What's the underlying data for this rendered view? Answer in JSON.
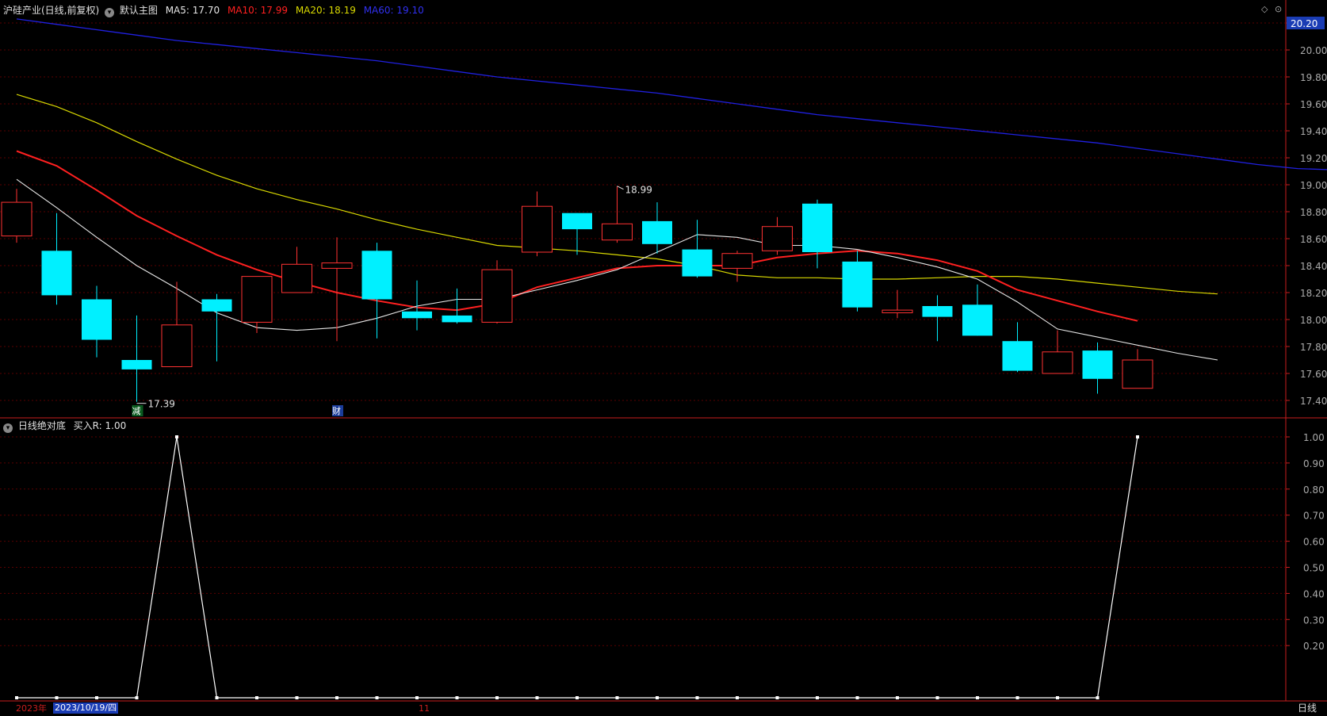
{
  "header": {
    "stock_title": "沪硅产业(日线,前复权)",
    "main_chart_label": "默认主图",
    "ma5_label": "MA5: 17.70",
    "ma10_label": "MA10: 17.99",
    "ma20_label": "MA20: 18.19",
    "ma60_label": "MA60: 19.10"
  },
  "indicator_header": {
    "name": "日线绝对底",
    "value_label": "买入R: 1.00"
  },
  "colors": {
    "background": "#000000",
    "grid": "#5a0000",
    "axis": "#c81e1e",
    "up": "#ff3232",
    "down": "#00f0ff",
    "ma5": "#e6e6e6",
    "ma10": "#ff2020",
    "ma20": "#d8d800",
    "ma60": "#2020e0",
    "indicator": "#ffffff",
    "current_price_bg": "#1a3cb4"
  },
  "price_axis": {
    "ticks": [
      "20.20",
      "20.00",
      "19.80",
      "19.60",
      "19.40",
      "19.20",
      "19.00",
      "18.80",
      "18.60",
      "18.40",
      "18.20",
      "18.00",
      "17.80",
      "17.60",
      "17.40"
    ],
    "highlight": "20.20"
  },
  "indicator_axis": {
    "ticks": [
      "1.00",
      "0.90",
      "0.80",
      "0.70",
      "0.60",
      "0.50",
      "0.40",
      "0.30",
      "0.20"
    ]
  },
  "annotations": {
    "high_label": "18.99",
    "low_label": "17.39",
    "marker_reduce": "减",
    "marker_finance": "财"
  },
  "bottom_bar": {
    "year": "2023年",
    "cursor_date": "2023/10/19/四",
    "month_marker": "11",
    "period": "日线"
  },
  "chart_data": [
    {
      "type": "candlestick",
      "title": "沪硅产业(日线,前复权)",
      "ylim": [
        17.28,
        20.23
      ],
      "candles": [
        {
          "o": 18.62,
          "h": 18.97,
          "l": 18.57,
          "c": 18.87
        },
        {
          "o": 18.51,
          "h": 18.79,
          "l": 18.11,
          "c": 18.18
        },
        {
          "o": 18.15,
          "h": 18.25,
          "l": 17.72,
          "c": 17.85
        },
        {
          "o": 17.7,
          "h": 18.03,
          "l": 17.39,
          "c": 17.63
        },
        {
          "o": 17.65,
          "h": 18.28,
          "l": 17.65,
          "c": 17.96
        },
        {
          "o": 18.15,
          "h": 18.19,
          "l": 17.69,
          "c": 18.06
        },
        {
          "o": 17.98,
          "h": 18.32,
          "l": 17.9,
          "c": 18.32
        },
        {
          "o": 18.2,
          "h": 18.54,
          "l": 18.2,
          "c": 18.41
        },
        {
          "o": 18.38,
          "h": 18.61,
          "l": 17.84,
          "c": 18.42
        },
        {
          "o": 18.51,
          "h": 18.57,
          "l": 17.86,
          "c": 18.15
        },
        {
          "o": 18.06,
          "h": 18.29,
          "l": 17.92,
          "c": 18.01
        },
        {
          "o": 18.03,
          "h": 18.23,
          "l": 17.97,
          "c": 17.98
        },
        {
          "o": 17.98,
          "h": 18.44,
          "l": 17.97,
          "c": 18.37
        },
        {
          "o": 18.5,
          "h": 18.95,
          "l": 18.47,
          "c": 18.84
        },
        {
          "o": 18.79,
          "h": 18.79,
          "l": 18.48,
          "c": 18.67
        },
        {
          "o": 18.59,
          "h": 18.99,
          "l": 18.57,
          "c": 18.71
        },
        {
          "o": 18.73,
          "h": 18.87,
          "l": 18.49,
          "c": 18.56
        },
        {
          "o": 18.52,
          "h": 18.74,
          "l": 18.31,
          "c": 18.32
        },
        {
          "o": 18.38,
          "h": 18.51,
          "l": 18.28,
          "c": 18.49
        },
        {
          "o": 18.51,
          "h": 18.76,
          "l": 18.48,
          "c": 18.69
        },
        {
          "o": 18.86,
          "h": 18.89,
          "l": 18.38,
          "c": 18.5
        },
        {
          "o": 18.43,
          "h": 18.51,
          "l": 18.06,
          "c": 18.09
        },
        {
          "o": 18.05,
          "h": 18.22,
          "l": 18.01,
          "c": 18.07
        },
        {
          "o": 18.1,
          "h": 18.18,
          "l": 17.84,
          "c": 18.02
        },
        {
          "o": 18.11,
          "h": 18.26,
          "l": 17.88,
          "c": 17.88
        },
        {
          "o": 17.84,
          "h": 17.98,
          "l": 17.61,
          "c": 17.62
        },
        {
          "o": 17.6,
          "h": 17.92,
          "l": 17.6,
          "c": 17.76
        },
        {
          "o": 17.77,
          "h": 17.83,
          "l": 17.45,
          "c": 17.56
        },
        {
          "o": 17.49,
          "h": 17.78,
          "l": 17.49,
          "c": 17.7
        }
      ],
      "ma5": [
        19.04,
        18.83,
        18.61,
        18.4,
        18.23,
        18.05,
        17.94,
        17.92,
        17.94,
        18.01,
        18.1,
        18.15,
        18.15,
        18.22,
        18.29,
        18.37,
        18.5,
        18.63,
        18.61,
        18.55,
        18.55,
        18.52,
        18.46,
        18.39,
        18.3,
        18.13,
        17.93,
        17.87,
        17.81,
        17.75,
        17.7
      ],
      "ma10": [
        19.25,
        19.14,
        18.96,
        18.77,
        18.62,
        18.48,
        18.37,
        18.28,
        18.2,
        18.14,
        18.09,
        18.07,
        18.12,
        18.24,
        18.31,
        18.38,
        18.4,
        18.4,
        18.4,
        18.46,
        18.49,
        18.51,
        18.49,
        18.44,
        18.36,
        18.22,
        18.14,
        18.06,
        17.99
      ],
      "ma20": [
        19.67,
        19.58,
        19.46,
        19.32,
        19.19,
        19.07,
        18.97,
        18.89,
        18.82,
        18.74,
        18.67,
        18.61,
        18.55,
        18.53,
        18.51,
        18.48,
        18.45,
        18.4,
        18.33,
        18.31,
        18.31,
        18.3,
        18.3,
        18.31,
        18.32,
        18.32,
        18.3,
        18.27,
        18.24,
        18.21,
        18.19
      ],
      "ma60": [
        20.23,
        20.19,
        20.15,
        20.11,
        20.07,
        20.04,
        20.01,
        19.98,
        19.95,
        19.92,
        19.88,
        19.84,
        19.8,
        19.77,
        19.74,
        19.71,
        19.68,
        19.64,
        19.6,
        19.56,
        19.52,
        19.49,
        19.46,
        19.43,
        19.4,
        19.37,
        19.34,
        19.31,
        19.27,
        19.23,
        19.19,
        19.15,
        19.12,
        19.11,
        19.1
      ]
    },
    {
      "type": "line",
      "title": "日线绝对底",
      "ylim": [
        0,
        1.04
      ],
      "series": [
        {
          "name": "买入R",
          "values": [
            0,
            0,
            0,
            0,
            1,
            0,
            0,
            0,
            0,
            0,
            0,
            0,
            0,
            0,
            0,
            0,
            0,
            0,
            0,
            0,
            0,
            0,
            0,
            0,
            0,
            0,
            0,
            0,
            1
          ]
        }
      ]
    }
  ]
}
